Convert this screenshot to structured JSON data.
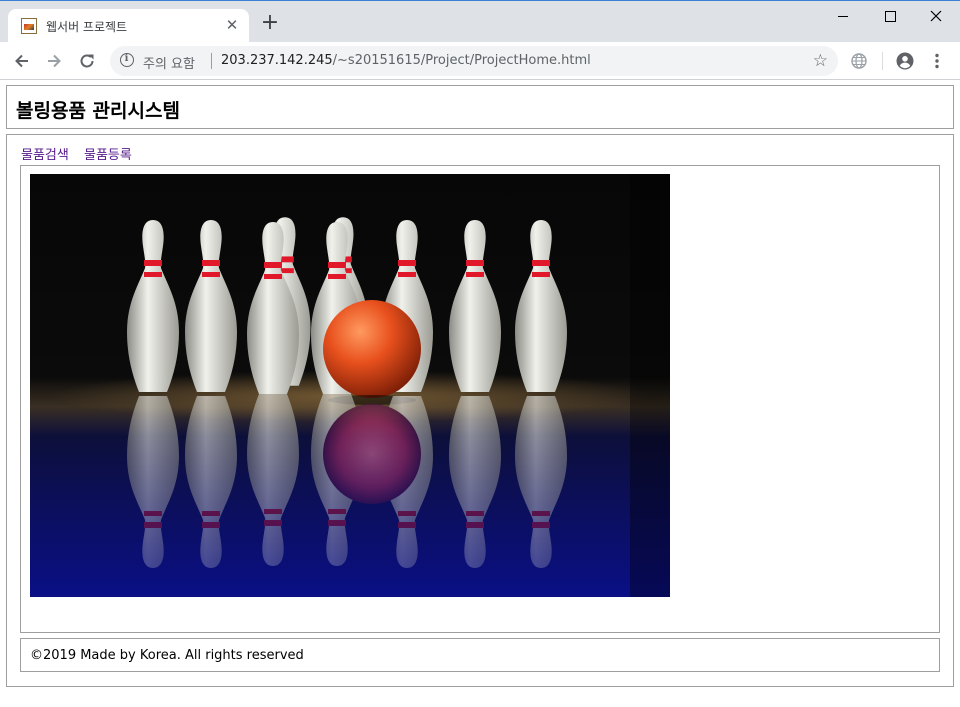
{
  "browser": {
    "tab_title": "웹서버 프로젝트",
    "security_label": "주의 요함",
    "url_host": "203.237.142.245",
    "url_path": "/~s20151615/Project/ProjectHome.html"
  },
  "header": {
    "title": "볼링용품 관리시스템"
  },
  "nav": {
    "links": [
      {
        "label": "물품검색"
      },
      {
        "label": "물품등록"
      }
    ]
  },
  "footer": {
    "text": "©2019 Made by Korea. All rights reserved"
  },
  "icons": [
    "favicon-icon",
    "close-icon",
    "plus-icon",
    "back-icon",
    "forward-icon",
    "reload-icon",
    "info-icon",
    "star-icon",
    "globe-icon",
    "profile-icon",
    "kebab-menu-icon",
    "minimize-icon",
    "maximize-icon",
    "window-close-icon"
  ],
  "colors": {
    "visited_link": "#551a8b",
    "frame": "#dee1e6",
    "border": "#9e9e9e"
  }
}
